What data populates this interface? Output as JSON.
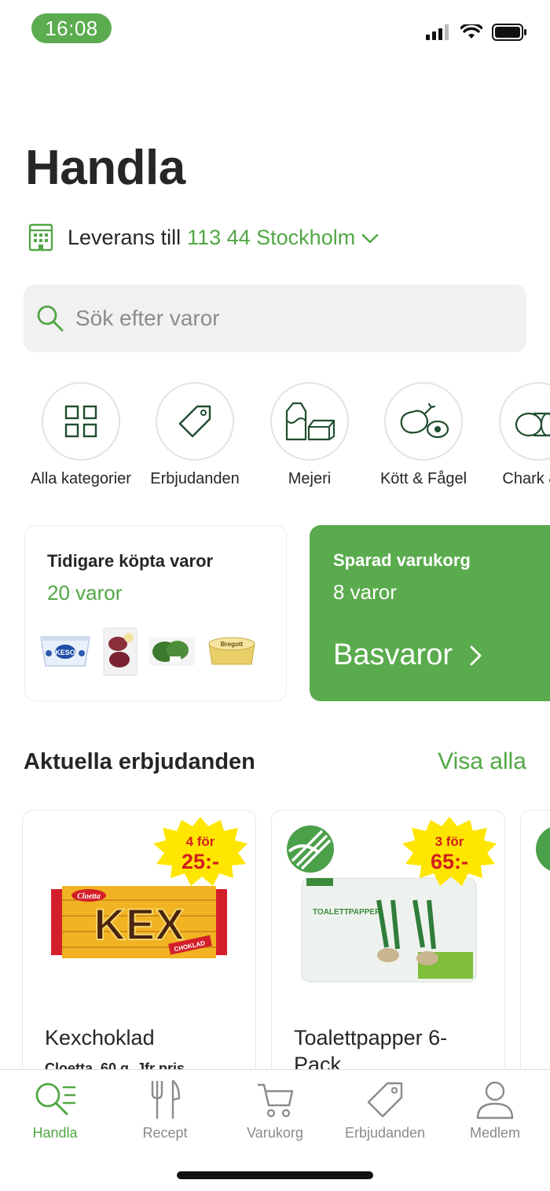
{
  "status": {
    "time": "16:08"
  },
  "header": {
    "title": "Handla"
  },
  "delivery": {
    "label": "Leverans till",
    "location": "113 44 Stockholm"
  },
  "search": {
    "placeholder": "Sök efter varor"
  },
  "categories": [
    {
      "label": "Alla kategorier",
      "icon": "grid-icon"
    },
    {
      "label": "Erbjudanden",
      "icon": "tag-icon"
    },
    {
      "label": "Mejeri",
      "icon": "dairy-icon"
    },
    {
      "label": "Kött & Fågel",
      "icon": "meat-icon"
    },
    {
      "label": "Chark & P",
      "icon": "deli-icon"
    }
  ],
  "previous_purchases": {
    "title": "Tidigare köpta varor",
    "count": "20 varor"
  },
  "saved_cart": {
    "title": "Sparad varukorg",
    "count": "8 varor",
    "list_name": "Basvaror"
  },
  "offers_section": {
    "title": "Aktuella erbjudanden",
    "link": "Visa alla"
  },
  "offers": [
    {
      "name": "Kexchoklad",
      "sub": "Cloetta. 60 g. Jfr pris",
      "deal_top": "4 för",
      "deal_price": "25:-"
    },
    {
      "name": "Toalettpapper 6-Pack",
      "deal_top": "3 för",
      "deal_price": "65:-"
    }
  ],
  "tabs": [
    {
      "label": "Handla",
      "icon": "shop-search-icon"
    },
    {
      "label": "Recept",
      "icon": "cutlery-icon"
    },
    {
      "label": "Varukorg",
      "icon": "cart-icon"
    },
    {
      "label": "Erbjudanden",
      "icon": "tag-icon"
    },
    {
      "label": "Medlem",
      "icon": "person-icon"
    }
  ],
  "colors": {
    "accent": "#52a745",
    "saved_card": "#5aab4d",
    "time_pill": "#5aac4e",
    "deal_burst": "#ffe600",
    "deal_text": "#d21f1f"
  }
}
